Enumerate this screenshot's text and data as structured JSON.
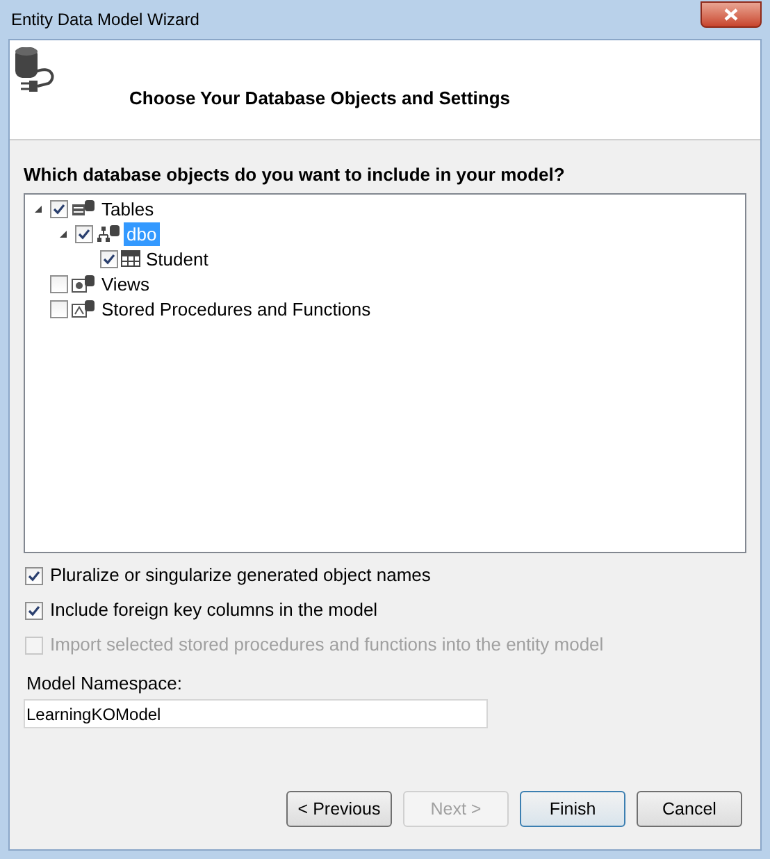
{
  "window": {
    "title": "Entity Data Model Wizard"
  },
  "header": {
    "title": "Choose Your Database Objects and Settings"
  },
  "tree": {
    "label": "Which database objects do you want to include in your model?",
    "items": [
      {
        "label": "Tables",
        "kind": "tables",
        "checked": true,
        "expanded": true,
        "selected": false,
        "children": [
          {
            "label": "dbo",
            "kind": "schema",
            "checked": true,
            "expanded": true,
            "selected": true,
            "children": [
              {
                "label": "Student",
                "kind": "table",
                "checked": true,
                "selected": false
              }
            ]
          }
        ]
      },
      {
        "label": "Views",
        "kind": "views",
        "checked": false,
        "selected": false
      },
      {
        "label": "Stored Procedures and Functions",
        "kind": "procs",
        "checked": false,
        "selected": false
      }
    ]
  },
  "options": [
    {
      "label": "Pluralize or singularize generated object names",
      "checked": true,
      "disabled": false
    },
    {
      "label": "Include foreign key columns in the model",
      "checked": true,
      "disabled": false
    },
    {
      "label": "Import selected stored procedures and functions into the entity model",
      "checked": false,
      "disabled": true
    }
  ],
  "namespace": {
    "label": "Model Namespace:",
    "value": "LearningKOModel"
  },
  "buttons": [
    {
      "label": "< Previous",
      "disabled": false,
      "default": false
    },
    {
      "label": "Next >",
      "disabled": true,
      "default": false
    },
    {
      "label": "Finish",
      "disabled": false,
      "default": true
    },
    {
      "label": "Cancel",
      "disabled": false,
      "default": false
    }
  ]
}
